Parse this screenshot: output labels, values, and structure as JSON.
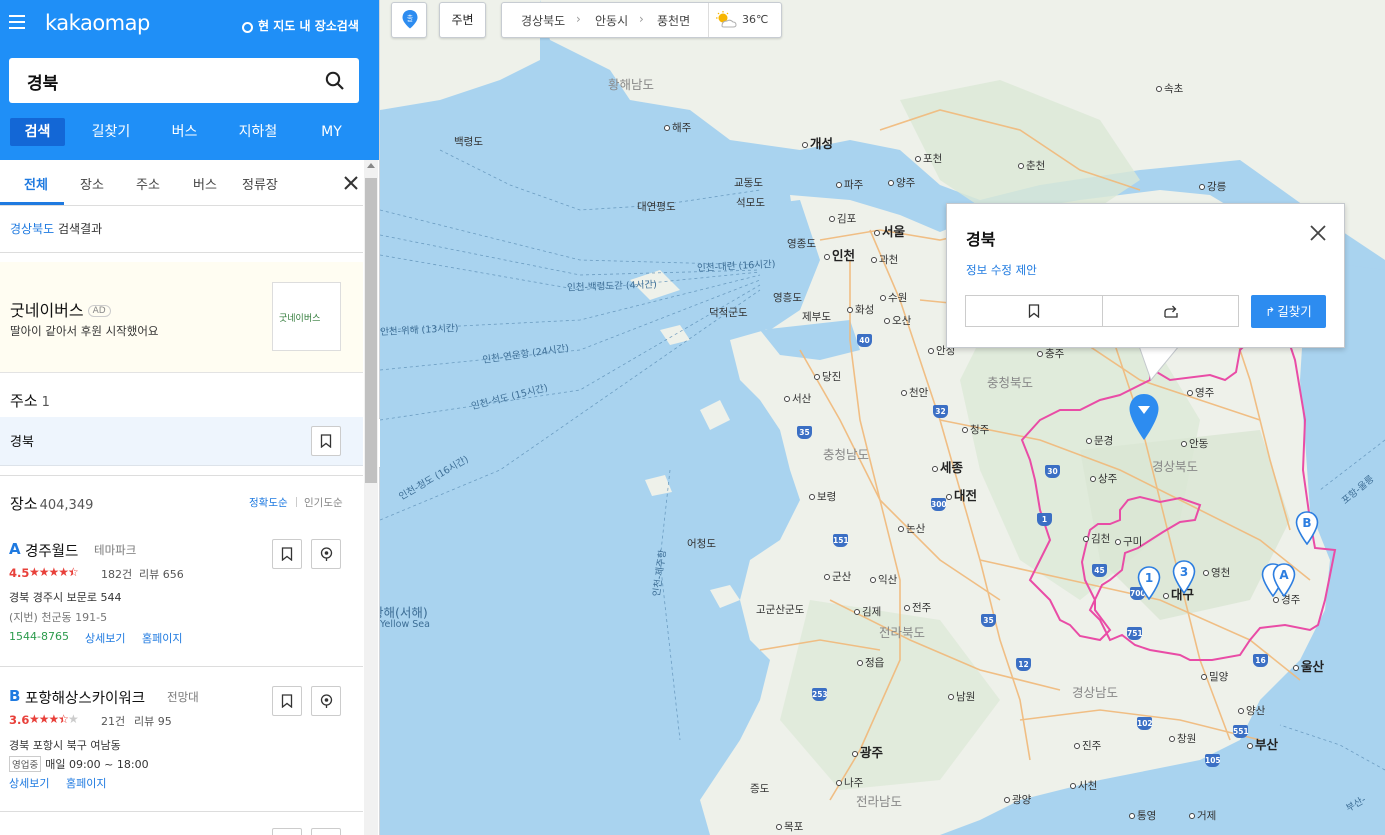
{
  "header": {
    "logo_text": "kakaomap",
    "local_search_label": "현 지도 내 장소검색",
    "search_value": "경북",
    "tabs": [
      "검색",
      "길찾기",
      "버스",
      "지하철",
      "MY"
    ]
  },
  "subtabs": [
    "전체",
    "장소",
    "주소",
    "버스",
    "정류장"
  ],
  "result_title": {
    "region": "경상북도",
    "suffix": " 검색결과"
  },
  "ad": {
    "name": "굿네이버스",
    "badge": "AD",
    "description": "딸아이 같아서 후원 시작했어요",
    "logo_text": "굿네이버스"
  },
  "address_section": {
    "title": "주소",
    "count": "1",
    "item": "경북"
  },
  "places_section": {
    "title": "장소",
    "count": "404,349",
    "sort_accuracy": "정확도순",
    "sort_popularity": "인기도순"
  },
  "places": [
    {
      "letter": "A",
      "name": "경주월드",
      "category": "테마파크",
      "rating": "4.5",
      "stars": 4.5,
      "review_count": "182건",
      "review_label": "리뷰 656",
      "address": "경북 경주시 보문로 544",
      "lot_address": "(지번) 천군동 191-5",
      "phone": "1544-8765",
      "detail_link": "상세보기",
      "home_link": "홈페이지"
    },
    {
      "letter": "B",
      "name": "포항해상스카이워크",
      "category": "전망대",
      "rating": "3.6",
      "stars": 3.5,
      "review_count": "21건",
      "review_label": "리뷰 95",
      "address": "경북 포항시 북구 여남동",
      "open_tag": "영업중",
      "hours": "매일 09:00 ~ 18:00",
      "detail_link": "상세보기",
      "home_link": "홈페이지"
    }
  ],
  "map": {
    "nearby_label": "주변",
    "breadcrumb": [
      "경상북도",
      "안동시",
      "풍천면"
    ],
    "weather_temp": "36℃",
    "location_button_label": "출",
    "infowindow": {
      "title": "경북",
      "edit_link": "정보 수정 제안",
      "route_button": "길찾기"
    },
    "sea_labels": {
      "yellow_ko": "황해(서해)",
      "yellow_en": "Yellow Sea",
      "routes": [
        "인천-대련 (16시간)",
        "인천-백령도간 (4시간)",
        "인천-위해 (13시간)",
        "인천-연운항 (24시간)",
        "인천-석도 (15시간)",
        "인천-청도 (16시간)",
        "인천-제주항",
        "포항-울릉",
        "부산-"
      ]
    },
    "provinces": [
      "황해남도",
      "충청북도",
      "경상북도",
      "충청남도",
      "전라북도",
      "경상남도",
      "전라남도"
    ],
    "cities": [
      "개성",
      "서울",
      "인천",
      "세종",
      "대전",
      "광주",
      "울산",
      "부산",
      "대구"
    ],
    "towns": [
      "해주",
      "포천",
      "춘천",
      "속초",
      "강릉",
      "파주",
      "양주",
      "김포",
      "과천",
      "수원",
      "화성",
      "오산",
      "안성",
      "충주",
      "당진",
      "천안",
      "서산",
      "청주",
      "영주",
      "문경",
      "안동",
      "상주",
      "보령",
      "논산",
      "김천",
      "구미",
      "영천",
      "경주",
      "군산",
      "익산",
      "김제",
      "전주",
      "정읍",
      "남원",
      "밀양",
      "양산",
      "진주",
      "창원",
      "나주",
      "사천",
      "광양",
      "통영",
      "거제",
      "목포"
    ],
    "islands": [
      "백령도",
      "연평도",
      "교동도",
      "석모도",
      "대연평도",
      "영종도",
      "영흥도",
      "덕적군도",
      "제부도",
      "어청도",
      "고군산군도",
      "증도"
    ],
    "highways": [
      "40",
      "32",
      "35",
      "30",
      "1",
      "300",
      "151",
      "45",
      "700",
      "751",
      "16",
      "12",
      "253",
      "102",
      "551",
      "105",
      "35"
    ],
    "markers": [
      "1",
      "3",
      "A",
      "B"
    ],
    "colors": {
      "accent": "#1f8ff7",
      "region_border": "#e94ca6",
      "sea": "#a9d3ef"
    }
  }
}
